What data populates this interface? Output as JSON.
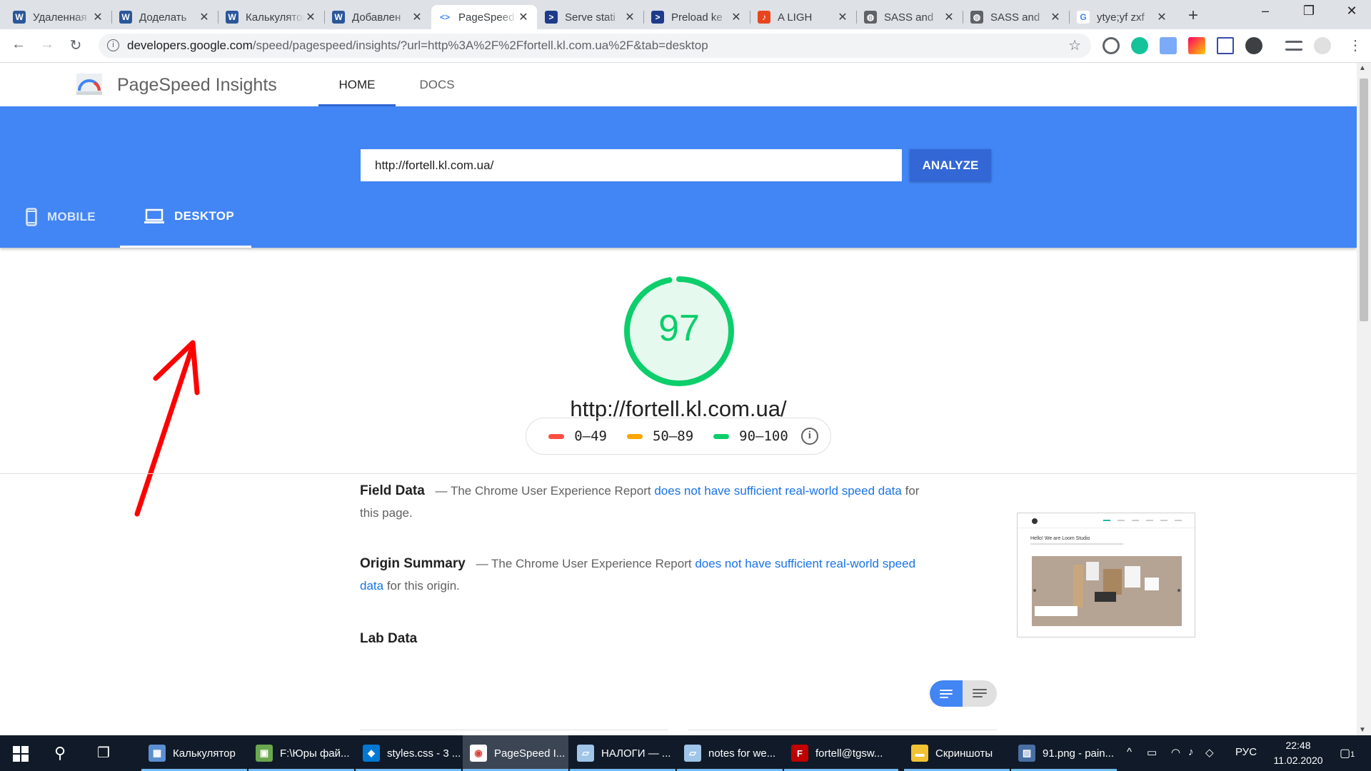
{
  "browser": {
    "tabs": [
      {
        "label": "Удаленная",
        "icon": "word-icon",
        "color": "#2b579a",
        "glyph": "W"
      },
      {
        "label": "Доделать",
        "icon": "word-icon",
        "color": "#2b579a",
        "glyph": "W"
      },
      {
        "label": "Калькулятор",
        "icon": "word-icon",
        "color": "#2b579a",
        "glyph": "W"
      },
      {
        "label": "Добавлен",
        "icon": "word-icon",
        "color": "#2b579a",
        "glyph": "W"
      },
      {
        "label": "PageSpeed",
        "icon": "pagespeed-icon",
        "color": "#ffffff",
        "glyph": "<>"
      },
      {
        "label": "Serve stati",
        "icon": "powershell-icon",
        "color": "#1e3a8a",
        "glyph": ">"
      },
      {
        "label": "Preload ke",
        "icon": "powershell-icon",
        "color": "#1e3a8a",
        "glyph": ">"
      },
      {
        "label": "A LIGH",
        "icon": "music-icon",
        "color": "#e8451e",
        "glyph": "♪"
      },
      {
        "label": "SASS and",
        "icon": "globe-icon",
        "color": "#5f6368",
        "glyph": "◍"
      },
      {
        "label": "SASS and",
        "icon": "globe-icon",
        "color": "#5f6368",
        "glyph": "◍"
      },
      {
        "label": "ytye;yf zxf",
        "icon": "google-icon",
        "color": "#ffffff",
        "glyph": "G"
      }
    ],
    "new_tab": "+",
    "window_controls": {
      "minimize": "–",
      "restore": "❐",
      "close": "✕"
    },
    "url_host": "developers.google.com",
    "url_path": "/speed/pagespeed/insights/?url=http%3A%2F%2Ffortell.kl.com.ua%2F&tab=desktop"
  },
  "psi": {
    "title": "PageSpeed Insights",
    "nav": {
      "home": "HOME",
      "docs": "DOCS"
    },
    "input_value": "http://fortell.kl.com.ua/",
    "analyze": "ANALYZE",
    "device_tabs": {
      "mobile": "MOBILE",
      "desktop": "DESKTOP"
    },
    "score": "97",
    "score_fraction": 0.97,
    "score_color": "#0cce6b",
    "tested_url": "http://fortell.kl.com.ua/",
    "legend": [
      {
        "label": "0–49",
        "color": "#ff4e42"
      },
      {
        "label": "50–89",
        "color": "#ffa400"
      },
      {
        "label": "90–100",
        "color": "#0cce6b"
      }
    ],
    "field_data": {
      "heading": "Field Data",
      "prefix": "— The Chrome User Experience Report",
      "link": "does not have sufficient real-world speed data",
      "suffix": "for this page."
    },
    "origin_summary": {
      "heading": "Origin Summary",
      "prefix": "— The Chrome User Experience Report",
      "link": "does not have sufficient real-world speed data",
      "suffix": "for this origin."
    },
    "lab_data": "Lab Data",
    "thumbnail_caption": "Hello! We are Loom Studio"
  },
  "taskbar": {
    "apps": [
      {
        "label": "Калькулятор",
        "color": "#5b8fd1",
        "glyph": "▦"
      },
      {
        "label": "F:\\Юры фай...",
        "color": "#6aa84f",
        "glyph": "▣"
      },
      {
        "label": "styles.css - 3 ...",
        "color": "#0078d4",
        "glyph": "◆"
      },
      {
        "label": "PageSpeed I...",
        "color": "#ffffff",
        "glyph": "◉"
      },
      {
        "label": "НАЛОГИ — ...",
        "color": "#9fc5e8",
        "glyph": "▱"
      },
      {
        "label": "notes for we...",
        "color": "#9fc5e8",
        "glyph": "▱"
      },
      {
        "label": "fortell@tgsw...",
        "color": "#bf0000",
        "glyph": "F"
      },
      {
        "label": "Скриншоты",
        "color": "#f1c232",
        "glyph": "▬"
      },
      {
        "label": "91.png - pain...",
        "color": "#4a6fa5",
        "glyph": "▨"
      }
    ],
    "lang": "РУС",
    "time": "22:48",
    "date": "11.02.2020",
    "notifications": "1"
  }
}
